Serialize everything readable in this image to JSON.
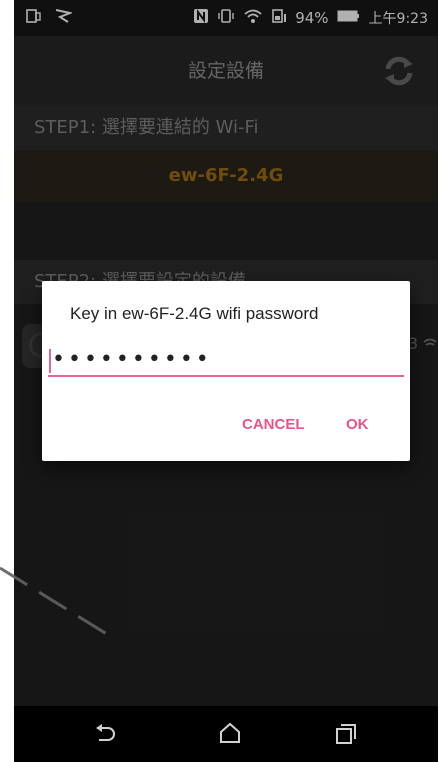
{
  "status_bar": {
    "battery": "94%",
    "time": "上午9:23"
  },
  "toolbar": {
    "title": "設定設備"
  },
  "step1": {
    "header": "STEP1: 選擇要連結的 Wi-Fi",
    "selected_wifi": "ew-6F-2.4G"
  },
  "step2": {
    "header": "STEP2: 選擇要設定的設備",
    "device_suffix": "3"
  },
  "dialog": {
    "title": "Key in ew-6F-2.4G wifi password",
    "password_value": "••••••••••",
    "cancel_label": "CANCEL",
    "ok_label": "OK"
  },
  "colors": {
    "accent": "#e8558a",
    "wifi_text": "#8a5e0e"
  }
}
